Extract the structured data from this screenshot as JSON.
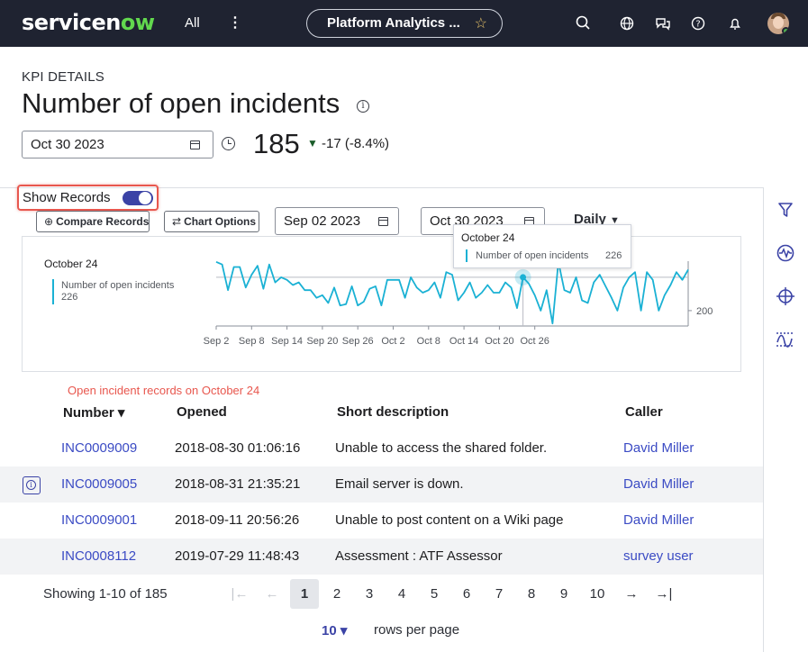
{
  "nav": {
    "logo_pre": "servicen",
    "logo_accent": "ow",
    "all_label": "All",
    "kebab": "⋮",
    "pill_title": "Platform Analytics ...",
    "star": "☆"
  },
  "header": {
    "kpi_label": "KPI DETAILS",
    "title": "Number of open incidents",
    "date": "Oct 30 2023",
    "value": "185",
    "arrow": "▼",
    "change": "-17 (-8.4%)"
  },
  "controls": {
    "show_records_label": "Show Records",
    "show_records_on": true,
    "compare_label": "Compare Records",
    "chart_options_label": "Chart Options",
    "start_date": "Sep 02 2023",
    "end_date": "Oct 30 2023",
    "granularity": "Daily"
  },
  "chart_legend": {
    "date": "October 24",
    "series": "Number of open incidents",
    "value": "226"
  },
  "tooltip": {
    "date": "October 24",
    "series": "Number of open incidents",
    "value": "226"
  },
  "chart_data": {
    "type": "line",
    "x": [
      "Sep 2",
      "Sep 3",
      "Sep 4",
      "Sep 5",
      "Sep 6",
      "Sep 7",
      "Sep 8",
      "Sep 9",
      "Sep 10",
      "Sep 11",
      "Sep 12",
      "Sep 13",
      "Sep 14",
      "Sep 15",
      "Sep 16",
      "Sep 17",
      "Sep 18",
      "Sep 19",
      "Sep 20",
      "Sep 21",
      "Sep 22",
      "Sep 23",
      "Sep 24",
      "Sep 25",
      "Sep 26",
      "Sep 27",
      "Sep 28",
      "Sep 29",
      "Sep 30",
      "Oct 1",
      "Oct 2",
      "Oct 3",
      "Oct 4",
      "Oct 5",
      "Oct 6",
      "Oct 7",
      "Oct 8",
      "Oct 9",
      "Oct 10",
      "Oct 11",
      "Oct 12",
      "Oct 13",
      "Oct 14",
      "Oct 15",
      "Oct 16",
      "Oct 17",
      "Oct 18",
      "Oct 19",
      "Oct 20",
      "Oct 21",
      "Oct 22",
      "Oct 23",
      "Oct 24",
      "Oct 25",
      "Oct 26",
      "Oct 27",
      "Oct 28",
      "Oct 29",
      "Oct 30"
    ],
    "series": [
      {
        "name": "Number of open incidents",
        "values": [
          238,
          236,
          216,
          234,
          234,
          218,
          228,
          235,
          217,
          236,
          222,
          226,
          224,
          220,
          222,
          216,
          216,
          210,
          212,
          206,
          218,
          204,
          205,
          219,
          204,
          207,
          217,
          219,
          204,
          224,
          224,
          224,
          210,
          226,
          218,
          214,
          216,
          222,
          210,
          230,
          228,
          208,
          214,
          222,
          210,
          214,
          220,
          214,
          214,
          222,
          218,
          202,
          226,
          221,
          212,
          200,
          216,
          190,
          238,
          216,
          214,
          226,
          208,
          206,
          222,
          228,
          219,
          210,
          200,
          218,
          226,
          230,
          200,
          230,
          224,
          200,
          212,
          220,
          230,
          224,
          232
        ]
      }
    ],
    "x_ticks": [
      "Sep 2",
      "Sep 8",
      "Sep 14",
      "Sep 20",
      "Sep 26",
      "Oct 2",
      "Oct 8",
      "Oct 14",
      "Oct 20",
      "Oct 26"
    ],
    "y_ticks": [
      "200"
    ],
    "highlight_x": "Oct 24",
    "highlight_value": 226,
    "ylim": [
      188,
      240
    ]
  },
  "records_caption": "Open incident records on October 24",
  "table": {
    "headers": {
      "number": "Number",
      "sort_arrow": "▾",
      "opened": "Opened",
      "short_description": "Short description",
      "caller": "Caller"
    },
    "rows": [
      {
        "number": "INC0009009",
        "opened": "2018-08-30 01:06:16",
        "short_description": "Unable to access the shared folder.",
        "caller": "David Miller"
      },
      {
        "number": "INC0009005",
        "opened": "2018-08-31 21:35:21",
        "short_description": "Email server is down.",
        "caller": "David Miller"
      },
      {
        "number": "INC0009001",
        "opened": "2018-09-11 20:56:26",
        "short_description": "Unable to post content on a Wiki page",
        "caller": "David Miller"
      },
      {
        "number": "INC0008112",
        "opened": "2019-07-29 11:48:43",
        "short_description": "Assessment : ATF Assessor",
        "caller": "survey user"
      }
    ]
  },
  "pagination": {
    "showing": "Showing 1-10 of 185",
    "first": "|←",
    "prev": "←",
    "pages": [
      "1",
      "2",
      "3",
      "4",
      "5",
      "6",
      "7",
      "8",
      "9",
      "10"
    ],
    "current": "1",
    "next": "→",
    "last": "→|",
    "rows_per_page": "10 ▾",
    "rows_per_page_label": "rows per page"
  },
  "colors": {
    "nav_bg": "#1f2331",
    "accent": "#3b43a6",
    "line": "#1ab1d4",
    "highlight_border": "#e8574e"
  }
}
